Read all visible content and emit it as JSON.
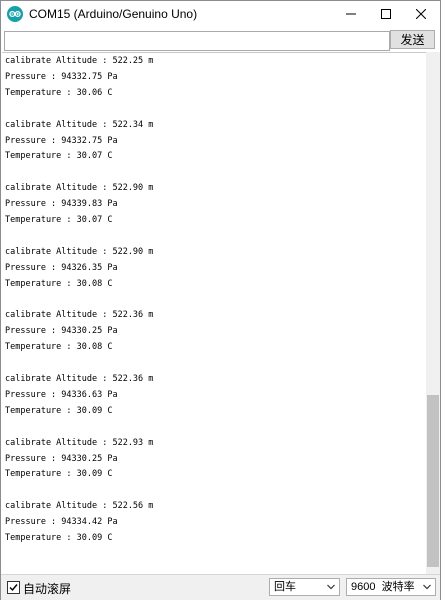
{
  "window": {
    "title": "COM15 (Arduino/Genuino Uno)"
  },
  "send": {
    "input_value": "",
    "button_label": "发送"
  },
  "output_lines": [
    "calibrate Altitude : 522.25 m",
    "Pressure : 94332.75 Pa",
    "Temperature : 30.06 C",
    "",
    "calibrate Altitude : 522.34 m",
    "Pressure : 94332.75 Pa",
    "Temperature : 30.07 C",
    "",
    "calibrate Altitude : 522.90 m",
    "Pressure : 94339.83 Pa",
    "Temperature : 30.07 C",
    "",
    "calibrate Altitude : 522.90 m",
    "Pressure : 94326.35 Pa",
    "Temperature : 30.08 C",
    "",
    "calibrate Altitude : 522.36 m",
    "Pressure : 94330.25 Pa",
    "Temperature : 30.08 C",
    "",
    "calibrate Altitude : 522.36 m",
    "Pressure : 94336.63 Pa",
    "Temperature : 30.09 C",
    "",
    "calibrate Altitude : 522.93 m",
    "Pressure : 94330.25 Pa",
    "Temperature : 30.09 C",
    "",
    "calibrate Altitude : 522.56 m",
    "Pressure : 94334.42 Pa",
    "Temperature : 30.09 C"
  ],
  "statusbar": {
    "autoscroll_label": "自动滚屏",
    "autoscroll_checked": true,
    "line_ending": "回车",
    "baud_rate": "9600  波特率"
  },
  "icons": {
    "app": "arduino-icon",
    "minimize": "minimize-icon",
    "maximize": "maximize-icon",
    "close": "close-icon",
    "checkbox": "check-icon",
    "dropdown": "chevron-down-icon"
  },
  "colors": {
    "app_icon": "#16a0a8",
    "scroll_thumb": "#c2c2c2"
  }
}
